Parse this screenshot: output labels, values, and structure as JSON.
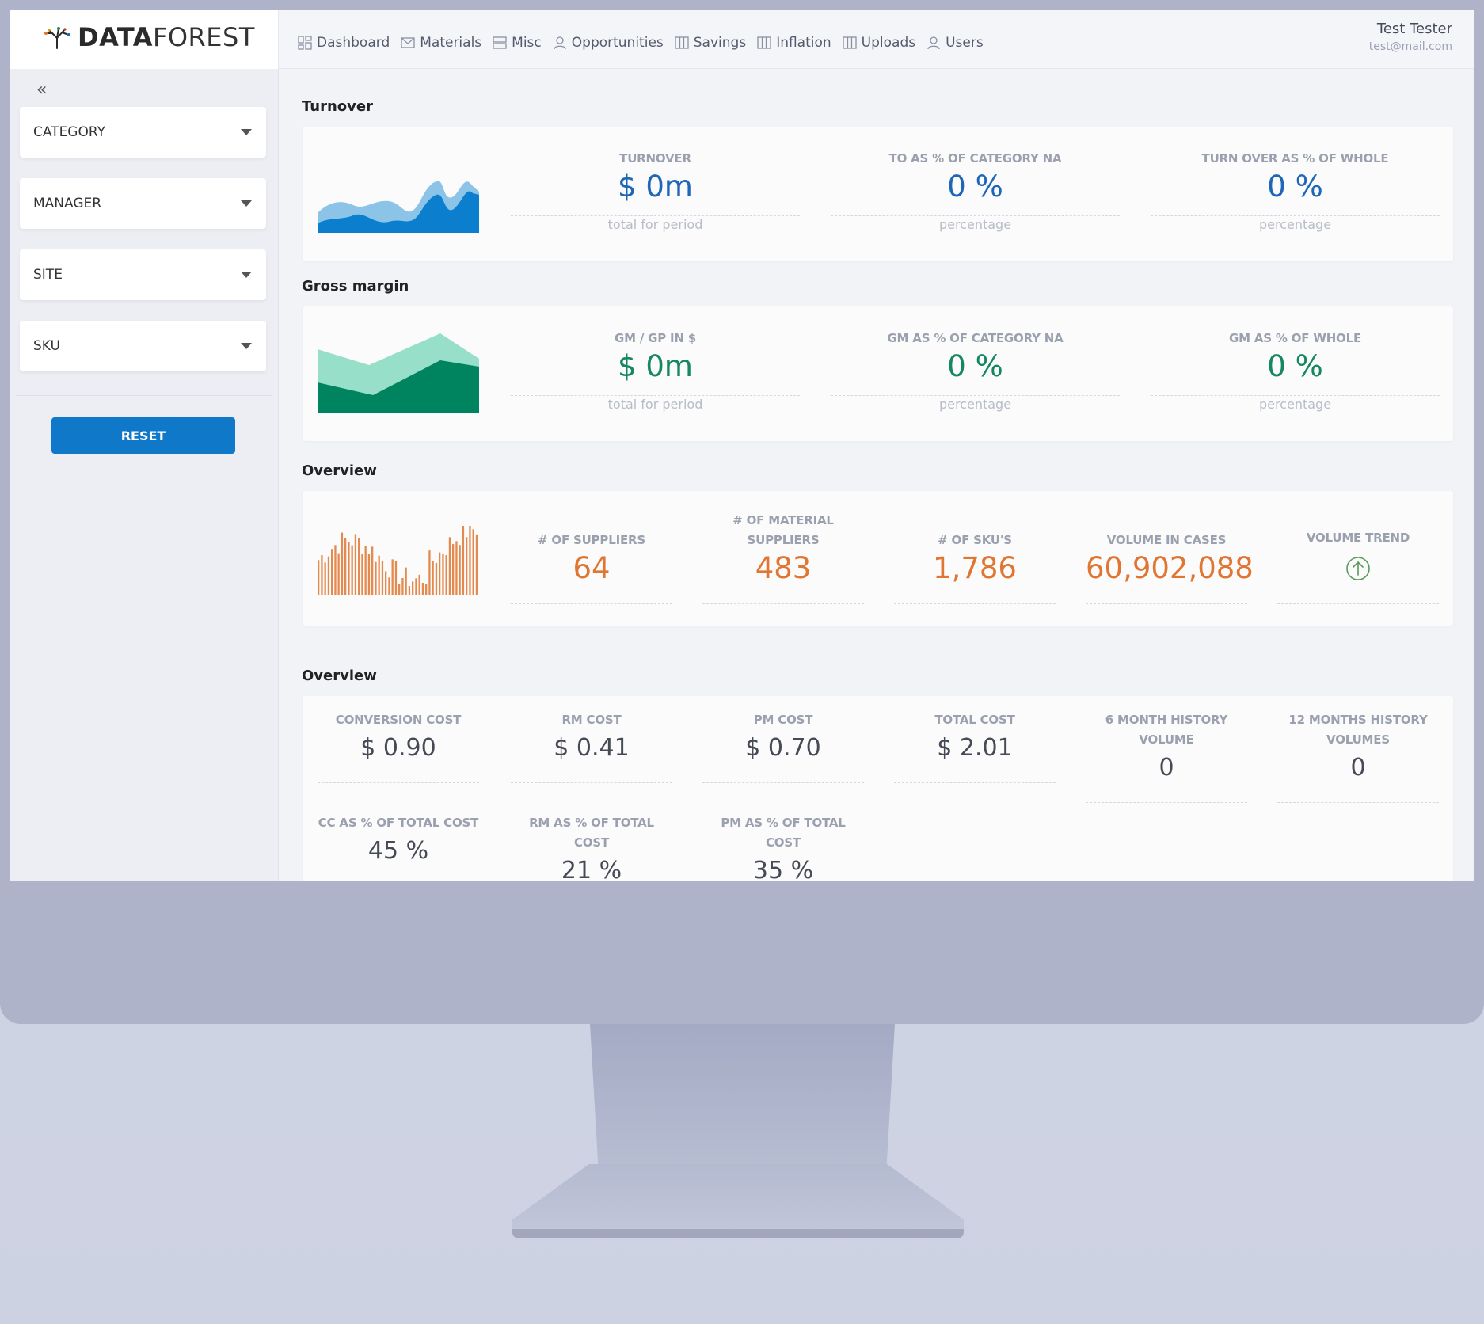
{
  "brand": {
    "bold": "DATA",
    "thin": "FOREST"
  },
  "nav": [
    {
      "label": "Dashboard",
      "icon": "dashboard-icon"
    },
    {
      "label": "Materials",
      "icon": "mail-icon"
    },
    {
      "label": "Misc",
      "icon": "server-icon"
    },
    {
      "label": "Opportunities",
      "icon": "user-icon"
    },
    {
      "label": "Savings",
      "icon": "columns-icon"
    },
    {
      "label": "Inflation",
      "icon": "columns-icon"
    },
    {
      "label": "Uploads",
      "icon": "columns-icon"
    },
    {
      "label": "Users",
      "icon": "user-icon"
    }
  ],
  "user": {
    "name": "Test Tester",
    "email": "test@mail.com"
  },
  "sidebar": {
    "collapse": "«",
    "filters": [
      "CATEGORY",
      "MANAGER",
      "SITE",
      "SKU"
    ],
    "reset_label": "RESET"
  },
  "turnover": {
    "title": "Turnover",
    "kpis": [
      {
        "label": "TURNOVER",
        "value": "$ 0m",
        "sub": "total for period"
      },
      {
        "label": "TO AS % OF CATEGORY NA",
        "value": "0 %",
        "sub": "percentage"
      },
      {
        "label": "TURN OVER AS % OF WHOLE",
        "value": "0 %",
        "sub": "percentage"
      }
    ]
  },
  "gross_margin": {
    "title": "Gross margin",
    "kpis": [
      {
        "label": "GM / GP IN $",
        "value": "$ 0m",
        "sub": "total for period"
      },
      {
        "label": "GM AS % OF CATEGORY NA",
        "value": "0 %",
        "sub": "percentage"
      },
      {
        "label": "GM AS % OF WHOLE",
        "value": "0 %",
        "sub": "percentage"
      }
    ]
  },
  "overview1": {
    "title": "Overview",
    "kpis": [
      {
        "label": "# OF SUPPLIERS",
        "value": "64"
      },
      {
        "label": "# OF MATERIAL SUPPLIERS",
        "value": "483"
      },
      {
        "label": "# OF SKU'S",
        "value": "1,786"
      },
      {
        "label": "VOLUME IN CASES",
        "value": "60,902,088"
      },
      {
        "label": "VOLUME TREND",
        "icon": "arrow-up-circle-icon"
      }
    ]
  },
  "overview2": {
    "title": "Overview",
    "kpis": [
      {
        "label": "CONVERSION COST",
        "value": "$ 0.90"
      },
      {
        "label": "RM COST",
        "value": "$ 0.41"
      },
      {
        "label": "PM COST",
        "value": "$ 0.70"
      },
      {
        "label": "TOTAL COST",
        "value": "$ 2.01"
      },
      {
        "label": "6 MONTH HISTORY VOLUME",
        "value": "0"
      },
      {
        "label": "12 MONTHS HISTORY VOLUMES",
        "value": "0"
      },
      {
        "label": "CC AS % OF TOTAL COST",
        "value": "45 %"
      },
      {
        "label": "RM AS % OF TOTAL COST",
        "value": "21 %"
      },
      {
        "label": "PM AS % OF TOTAL COST",
        "value": "35 %"
      }
    ]
  },
  "colors": {
    "accent_blue": "#0f78c8",
    "turnover_value": "#1e66b8",
    "gm_value": "#16885f",
    "overview_value": "#e07632",
    "gm_dark": "#00845f",
    "gm_light": "#97dfc9",
    "turnover_dark": "#0b7fcd",
    "turnover_light": "#8cc4e8",
    "bars": "#e58a4f"
  }
}
